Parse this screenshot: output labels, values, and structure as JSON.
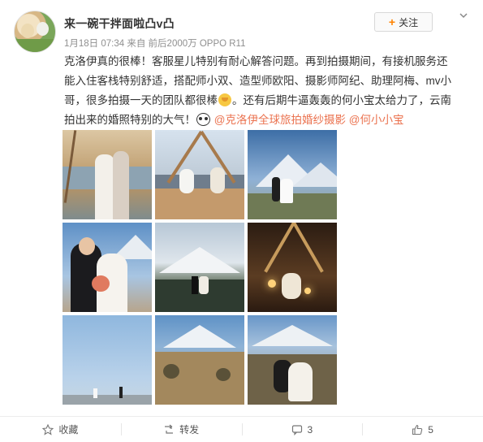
{
  "post": {
    "author": "来一碗干拌面啦凸v凸",
    "meta": "1月18日 07:34 来自 前后2000万 OPPO R11",
    "follow_label": "关注",
    "body": {
      "l1": "克洛伊真的很棒！客服星儿特别有耐心解答问题。再到拍摄期间，有接机服务还",
      "l2": "能入住客栈特别舒适，搭配师小双、造型师欧阳、摄影师阿纪、助理阿梅、mv小",
      "l3a": "哥，很多拍摄一天的团队都很棒",
      "l3b": "。还有后期牛逼轰轰的何小宝太给力了，云南",
      "l4a": "拍出来的婚照特别的大气！",
      "mention1": "@克洛伊全球旅拍婚纱摄影",
      "mention2": "@何小小宝"
    },
    "photos": [
      {
        "alt": "couple by lake with dry tree"
      },
      {
        "alt": "couple sitting under wooden tent frame"
      },
      {
        "alt": "couple in front of snow mountain"
      },
      {
        "alt": "groom kissing bride with bouquet"
      },
      {
        "alt": "couple on hillside with snow mountain"
      },
      {
        "alt": "couple at night with lights"
      },
      {
        "alt": "couple on blue sky hilltop"
      },
      {
        "alt": "dry meadow with snow mountain"
      },
      {
        "alt": "couple on meadow with snow peaks"
      }
    ]
  },
  "actions": {
    "favorite": "收藏",
    "repost": "转发",
    "comments": "3",
    "likes": "5"
  },
  "colors": {
    "accent": "#ff8200",
    "mention": "#eb7350"
  }
}
